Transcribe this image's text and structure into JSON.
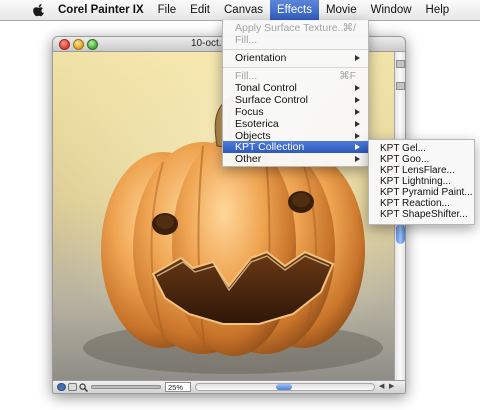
{
  "menubar": {
    "app": "Corel Painter IX",
    "items": [
      "File",
      "Edit",
      "Canvas",
      "Effects",
      "Movie",
      "Window",
      "Help"
    ],
    "active": "Effects"
  },
  "window": {
    "title": "10-oct."
  },
  "effects_menu": {
    "items": [
      {
        "label": "Apply Surface Texture...",
        "shortcut": "⌘/",
        "disabled": true,
        "submenu": false
      },
      {
        "label": "Fill...",
        "shortcut": "",
        "disabled": true,
        "submenu": false
      },
      {
        "label": "Orientation",
        "shortcut": "",
        "disabled": false,
        "submenu": true
      },
      {
        "label": "Fill...",
        "shortcut": "⌘F",
        "disabled": true,
        "submenu": false
      },
      {
        "label": "Tonal Control",
        "shortcut": "",
        "disabled": false,
        "submenu": true
      },
      {
        "label": "Surface Control",
        "shortcut": "",
        "disabled": false,
        "submenu": true
      },
      {
        "label": "Focus",
        "shortcut": "",
        "disabled": false,
        "submenu": true
      },
      {
        "label": "Esoterica",
        "shortcut": "",
        "disabled": false,
        "submenu": true
      },
      {
        "label": "Objects",
        "shortcut": "",
        "disabled": false,
        "submenu": true
      },
      {
        "label": "KPT Collection",
        "shortcut": "",
        "disabled": false,
        "submenu": true,
        "highlighted": true
      },
      {
        "label": "Other",
        "shortcut": "",
        "disabled": false,
        "submenu": true
      }
    ]
  },
  "kpt_menu": {
    "items": [
      "KPT Gel...",
      "KPT Goo...",
      "KPT LensFlare...",
      "KPT Lightning...",
      "KPT Pyramid Paint...",
      "KPT Reaction...",
      "KPT ShapeShifter..."
    ]
  },
  "statusbar": {
    "zoom": "25%"
  },
  "colors": {
    "highlight": "#2f5cc0",
    "pumpkin": "#e89a3c",
    "background": "#e8d9a0"
  },
  "icons": [
    "apple-icon",
    "close-icon",
    "minimize-icon",
    "zoom-icon",
    "submenu-arrow-icon",
    "grabber-icon",
    "magnifier-icon",
    "scroll-left-icon",
    "scroll-right-icon"
  ]
}
